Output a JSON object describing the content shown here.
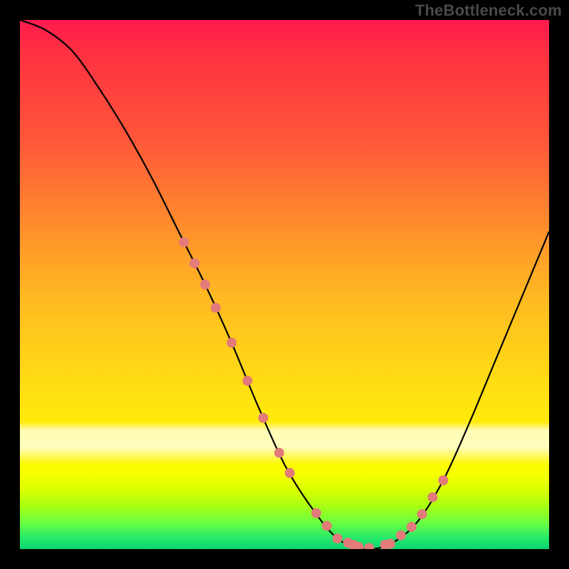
{
  "watermark": "TheBottleneck.com",
  "colors": {
    "background": "#000000",
    "grad_top": "#ff1a4f",
    "grad_mid": "#ffe012",
    "grad_bottom": "#07d56e",
    "curve": "#000000",
    "markers": "#e27b79",
    "watermark": "#4a4a4a"
  },
  "chart_data": {
    "type": "line",
    "title": "",
    "xlabel": "",
    "ylabel": "",
    "xlim": [
      0,
      100
    ],
    "ylim": [
      0,
      100
    ],
    "series": [
      {
        "name": "curve",
        "x": [
          0,
          5,
          10,
          15,
          20,
          25,
          30,
          35,
          40,
          45,
          50,
          55,
          60,
          65,
          70,
          75,
          80,
          85,
          90,
          95,
          100
        ],
        "y": [
          100,
          98,
          94,
          87,
          79,
          70,
          60,
          50,
          39,
          27,
          16,
          8,
          2,
          0,
          1,
          5,
          13,
          24,
          36,
          48,
          60
        ]
      }
    ],
    "markers": {
      "name": "highlighted-points",
      "x_left_cluster": [
        31,
        33,
        35,
        37,
        40,
        43,
        46,
        49,
        51
      ],
      "x_valley": [
        56,
        58,
        60,
        62,
        63,
        64,
        66
      ],
      "x_right_cluster": [
        69,
        70,
        72,
        74,
        76,
        78,
        80
      ]
    },
    "pale_band_y": [
      16,
      24
    ]
  }
}
